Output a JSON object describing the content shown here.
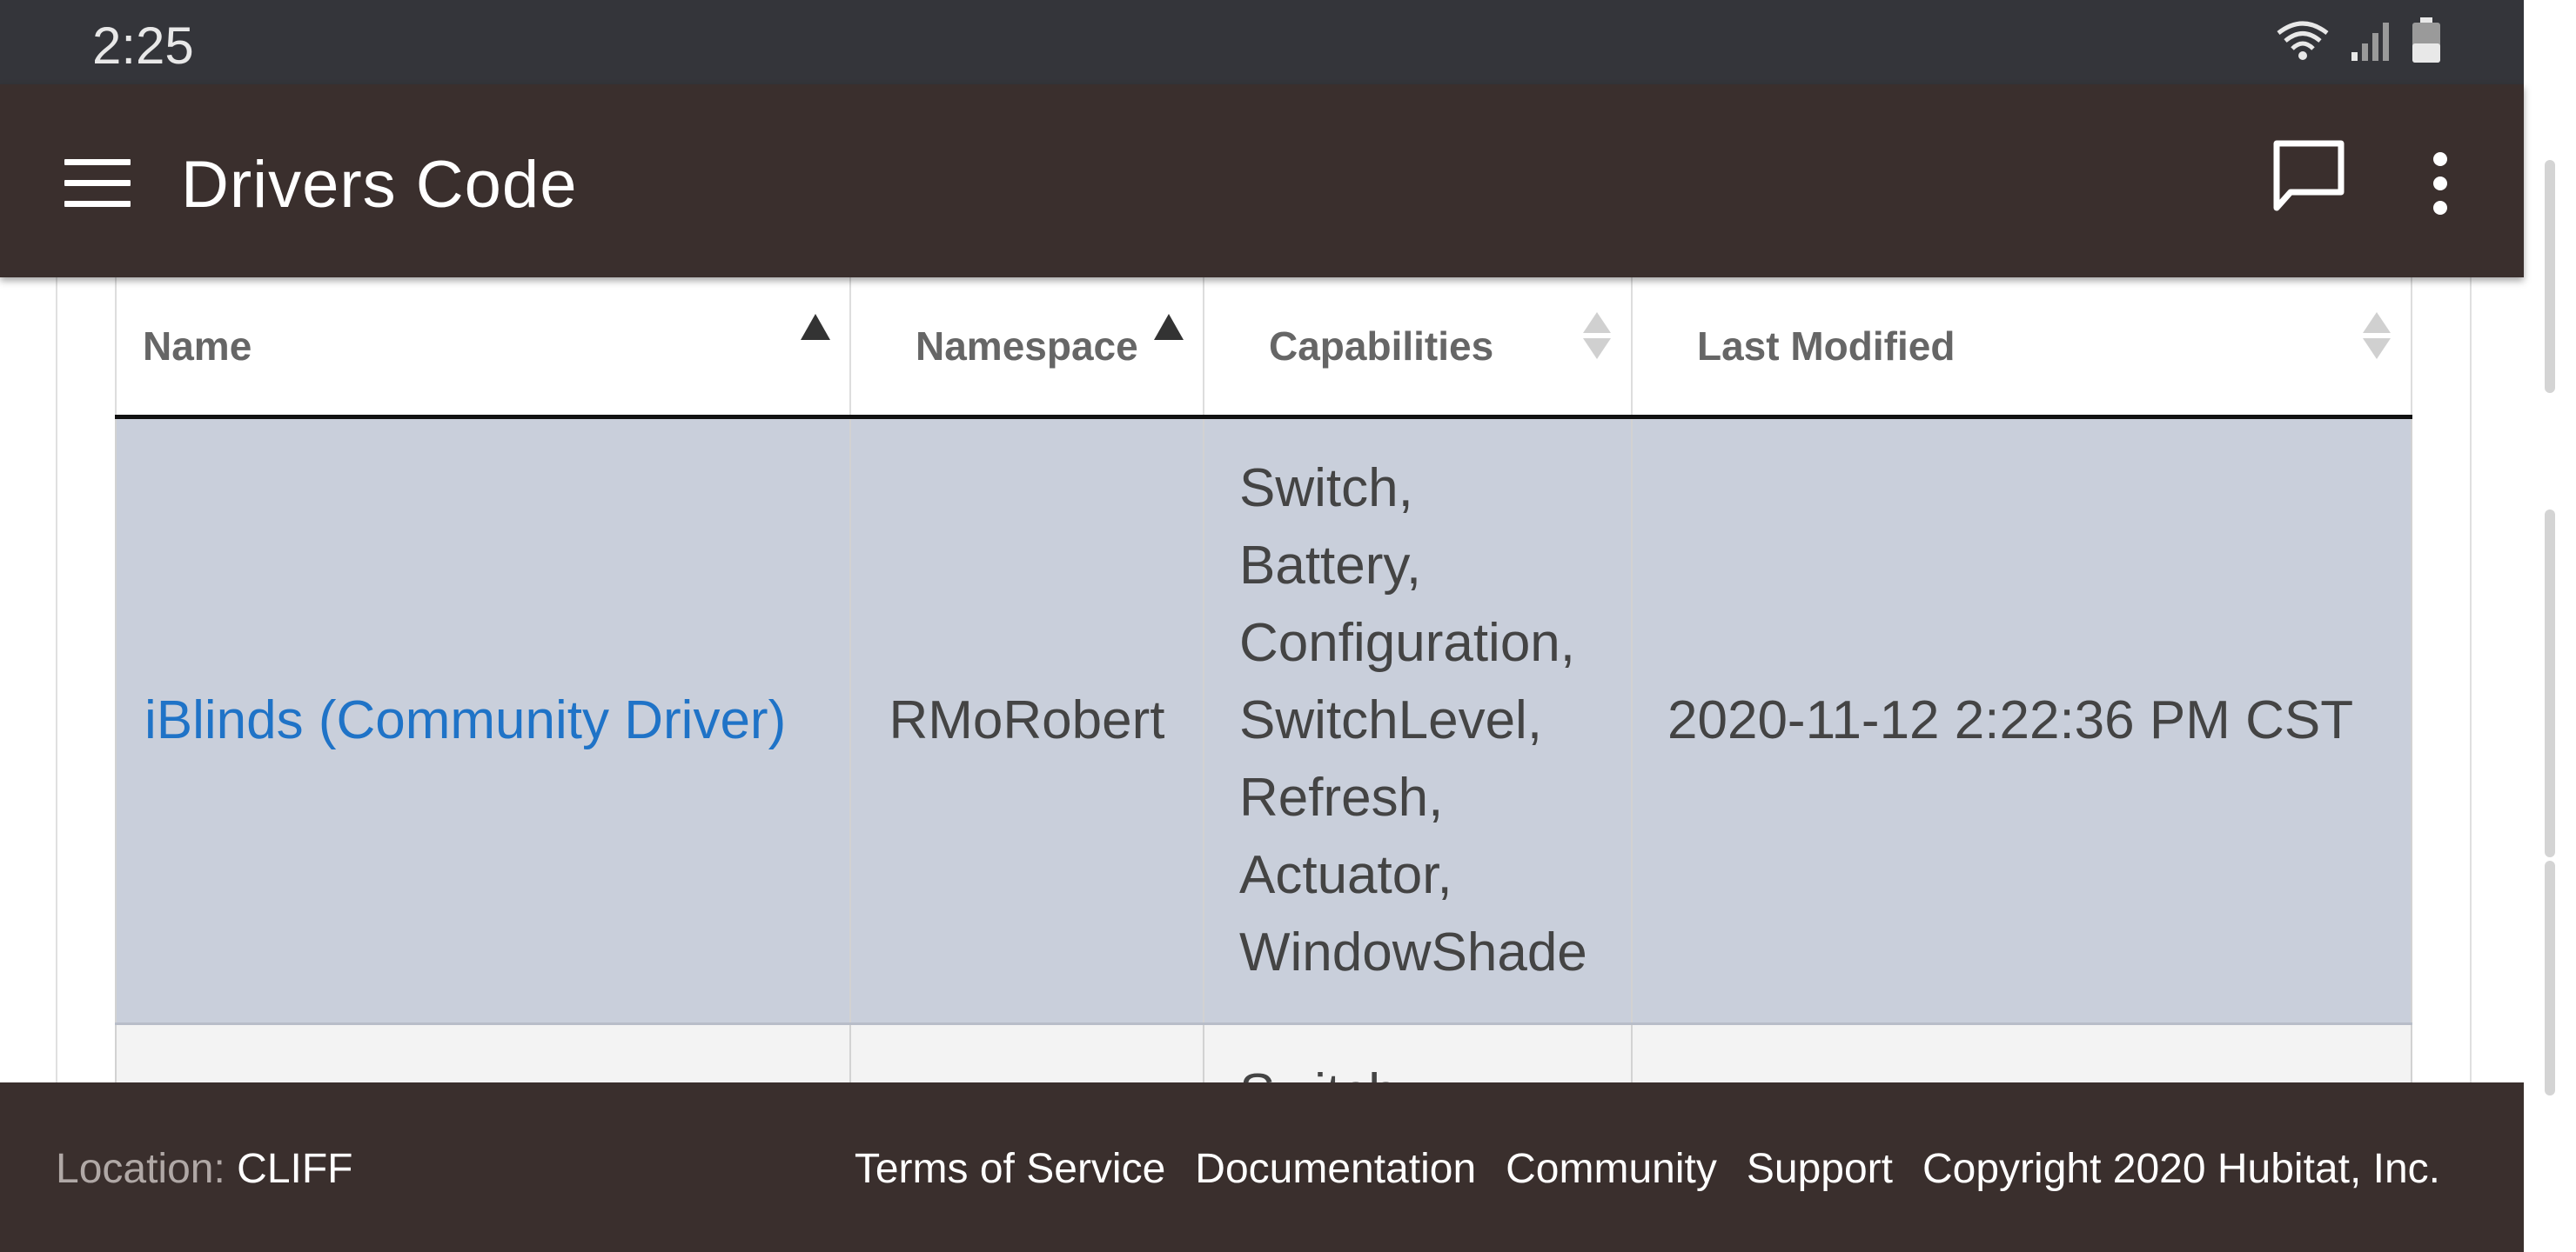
{
  "status_bar": {
    "time": "2:25",
    "icons": [
      "wifi-icon",
      "signal-icon",
      "battery-icon"
    ]
  },
  "app_bar": {
    "title": "Drivers Code",
    "icons": [
      "menu-icon",
      "chat-icon",
      "more-vert-icon"
    ]
  },
  "table": {
    "columns": [
      {
        "label": "Name",
        "sort": "ascending"
      },
      {
        "label": "Namespace",
        "sort": "ascending"
      },
      {
        "label": "Capabilities",
        "sort": "none"
      },
      {
        "label": "Last Modified",
        "sort": "none"
      }
    ],
    "rows": [
      {
        "name": "iBlinds (Community Driver)",
        "namespace": "RMoRobert",
        "capabilities": [
          "Switch,",
          "Battery,",
          "Configuration,",
          "SwitchLevel,",
          "Refresh,",
          "Actuator,",
          "WindowShade"
        ],
        "last_modified": "2020-11-12 2:22:36 PM CST"
      },
      {
        "capabilities_partial": "Switch,"
      }
    ]
  },
  "footer": {
    "location_label": "Location:",
    "location_value": "CLIFF",
    "links": [
      "Terms of Service",
      "Documentation",
      "Community",
      "Support"
    ],
    "copyright": "Copyright 2020 Hubitat, Inc."
  },
  "colors": {
    "status_bar_bg": "#34353a",
    "app_bar_bg": "#3a2f2d",
    "selected_row_bg": "#c9cfdb",
    "link": "#1f73c7"
  }
}
